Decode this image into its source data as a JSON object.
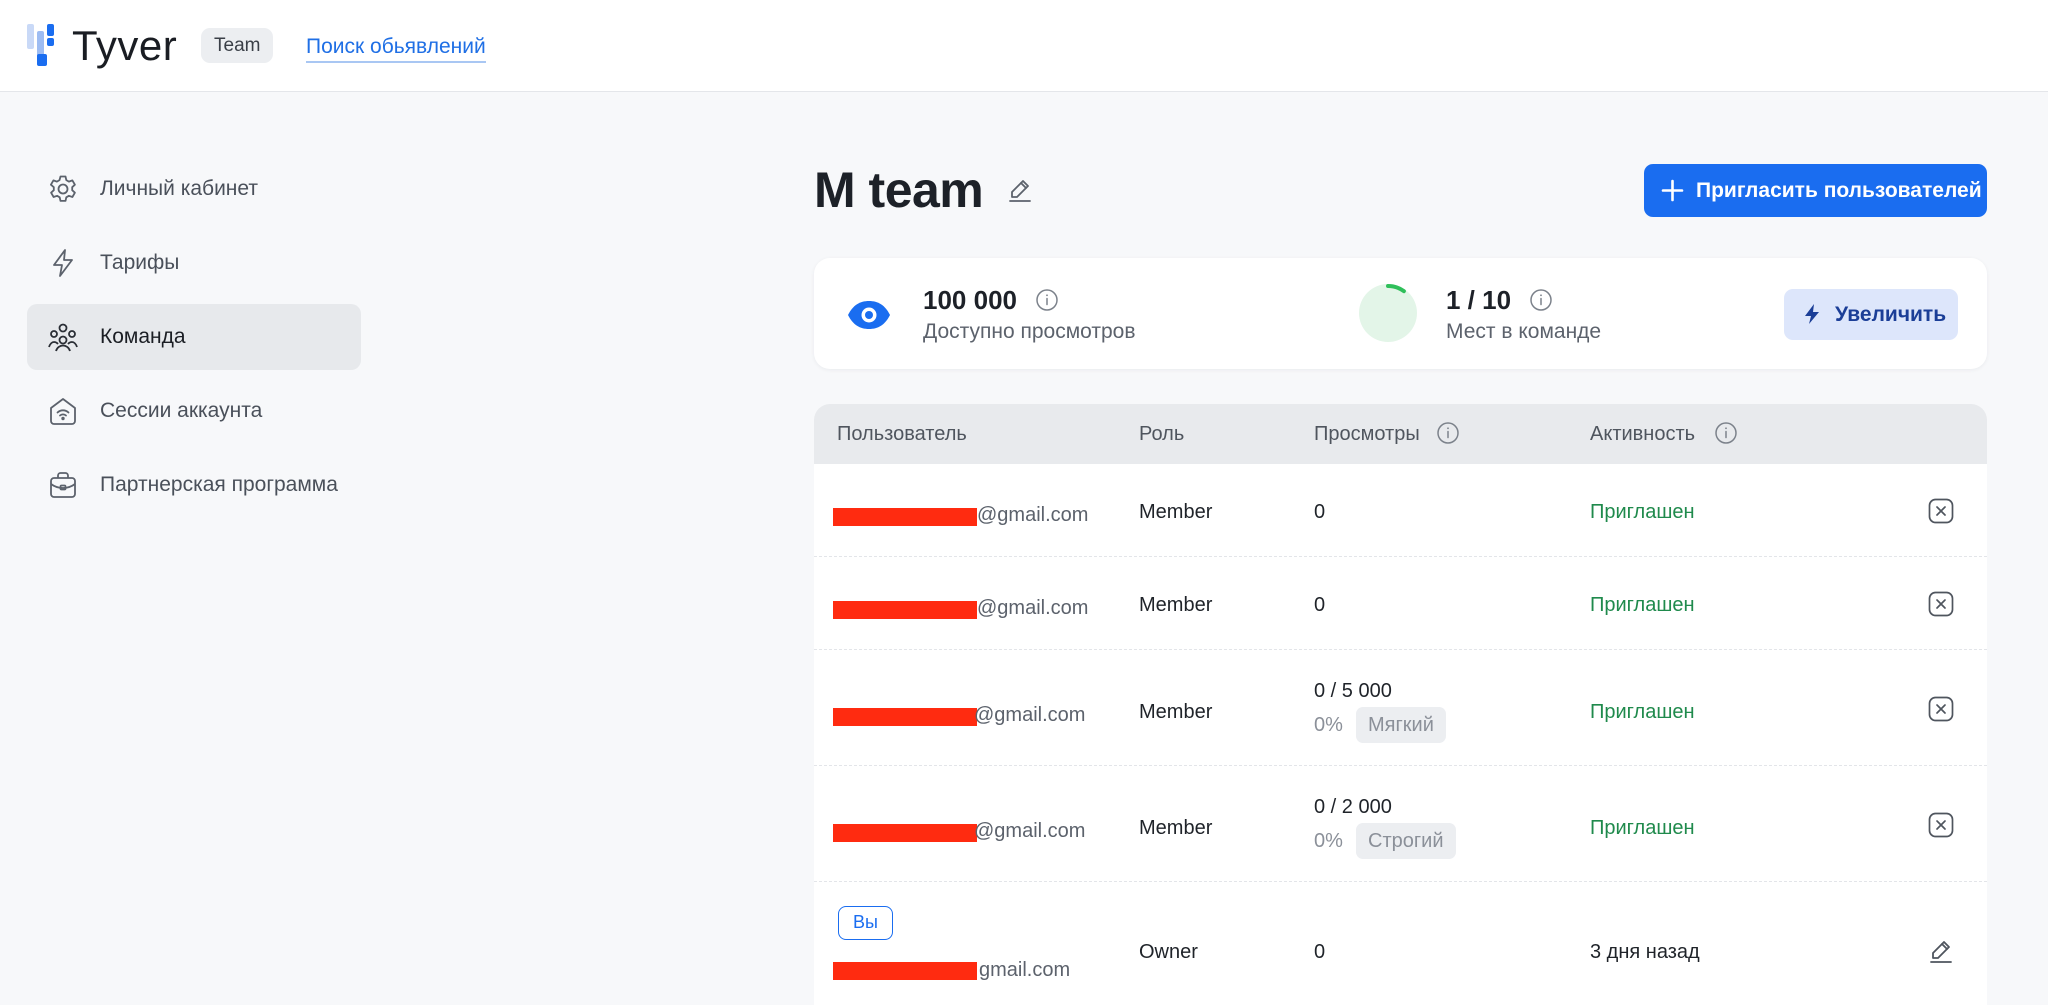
{
  "header": {
    "brand": "Tyver",
    "team_badge": "Team",
    "search_link": "Поиск обьявлений"
  },
  "sidebar": {
    "items": [
      {
        "label": "Личный кабинет",
        "icon": "gear-icon",
        "active": false
      },
      {
        "label": "Тарифы",
        "icon": "lightning-icon",
        "active": false
      },
      {
        "label": "Команда",
        "icon": "team-icon",
        "active": true
      },
      {
        "label": "Сессии аккаунта",
        "icon": "home-wifi-icon",
        "active": false
      },
      {
        "label": "Партнерская программа",
        "icon": "briefcase-icon",
        "active": false
      }
    ]
  },
  "main": {
    "title": "M team",
    "invite_button": "Пригласить пользователей",
    "stats": {
      "views_value": "100 000",
      "views_label": "Доступно просмотров",
      "seats_value": "1 / 10",
      "seats_label": "Мест в команде",
      "seats_fraction": 0.1,
      "increase_button": "Увеличить"
    },
    "table": {
      "columns": [
        "Пользователь",
        "Роль",
        "Просмотры",
        "Активность"
      ],
      "rows": [
        {
          "email": "@gmail.com",
          "role": "Member",
          "views": "0",
          "views_pct": "",
          "mode": "",
          "activity": "Приглашен",
          "action": "close-icon"
        },
        {
          "email": "@gmail.com",
          "role": "Member",
          "views": "0",
          "views_pct": "",
          "mode": "",
          "activity": "Приглашен",
          "action": "close-icon"
        },
        {
          "email": "@gmail.com",
          "role": "Member",
          "views": "0 / 5 000",
          "views_pct": "0%",
          "mode": "Мягкий",
          "activity": "Приглашен",
          "action": "close-icon"
        },
        {
          "email": "@gmail.com",
          "role": "Member",
          "views": "0 / 2 000",
          "views_pct": "0%",
          "mode": "Строгий",
          "activity": "Приглашен",
          "action": "close-icon"
        },
        {
          "email": "gmail.com",
          "role": "Owner",
          "views": "0",
          "views_pct": "",
          "mode": "",
          "activity": "3 дня назад",
          "action": "pencil-icon",
          "you_badge": "Вы"
        }
      ]
    }
  },
  "colors": {
    "accent": "#1a6df0",
    "invited": "#1f8a4c",
    "redaction": "#ff2b10",
    "seat_ring": "#2fbf5a"
  }
}
